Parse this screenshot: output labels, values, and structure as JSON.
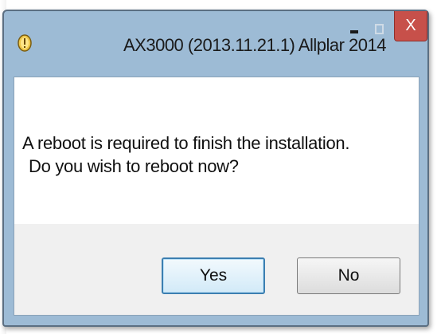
{
  "window": {
    "title": "AX3000  (2013.11.21.1) Allplar 2014",
    "app_icon": "warning-shield-icon",
    "minimize_icon": "minimize-icon",
    "maximize_icon": "maximize-icon",
    "close_label": "X",
    "close_color": "#c7504a"
  },
  "dialog": {
    "message_line1": "A reboot is required to finish the installation.",
    "message_line2": "Do you wish to reboot now?"
  },
  "buttons": {
    "yes_label": "Yes",
    "no_label": "No",
    "default_highlight_color": "#3c7fb1"
  }
}
